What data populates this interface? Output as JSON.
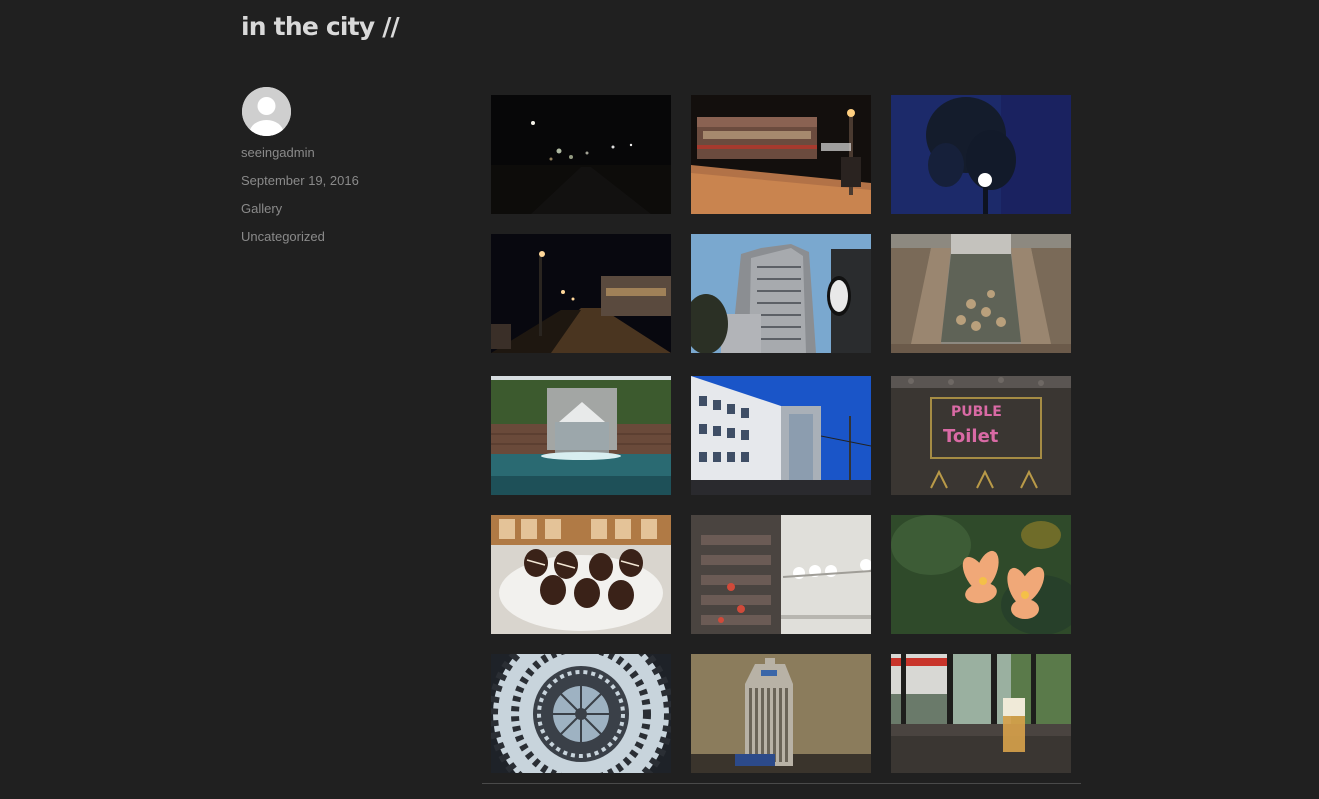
{
  "post": {
    "title": "in the city //"
  },
  "author": {
    "name": "seeingadmin",
    "avatar_icon": "avatar-placeholder-icon"
  },
  "meta": {
    "date": "September 19, 2016",
    "categories": [
      "Gallery",
      "Uncategorized"
    ]
  },
  "gallery": {
    "images": [
      "night-street-lights",
      "train-at-platform-night",
      "tree-and-lamp-dusk",
      "station-platform-night",
      "city-skyscraper",
      "fountain-benches",
      "water-fountain-wall",
      "city-buildings-blue-sky",
      "public-toilet-chalk",
      "chocolate-strawberries",
      "sideways-interior",
      "orange-lilies",
      "glass-dome-ceiling",
      "building-model",
      "window-drink-view"
    ]
  },
  "colors": {
    "background": "#202020",
    "title": "#d9d9d9",
    "meta_text": "#8a8a8a"
  }
}
